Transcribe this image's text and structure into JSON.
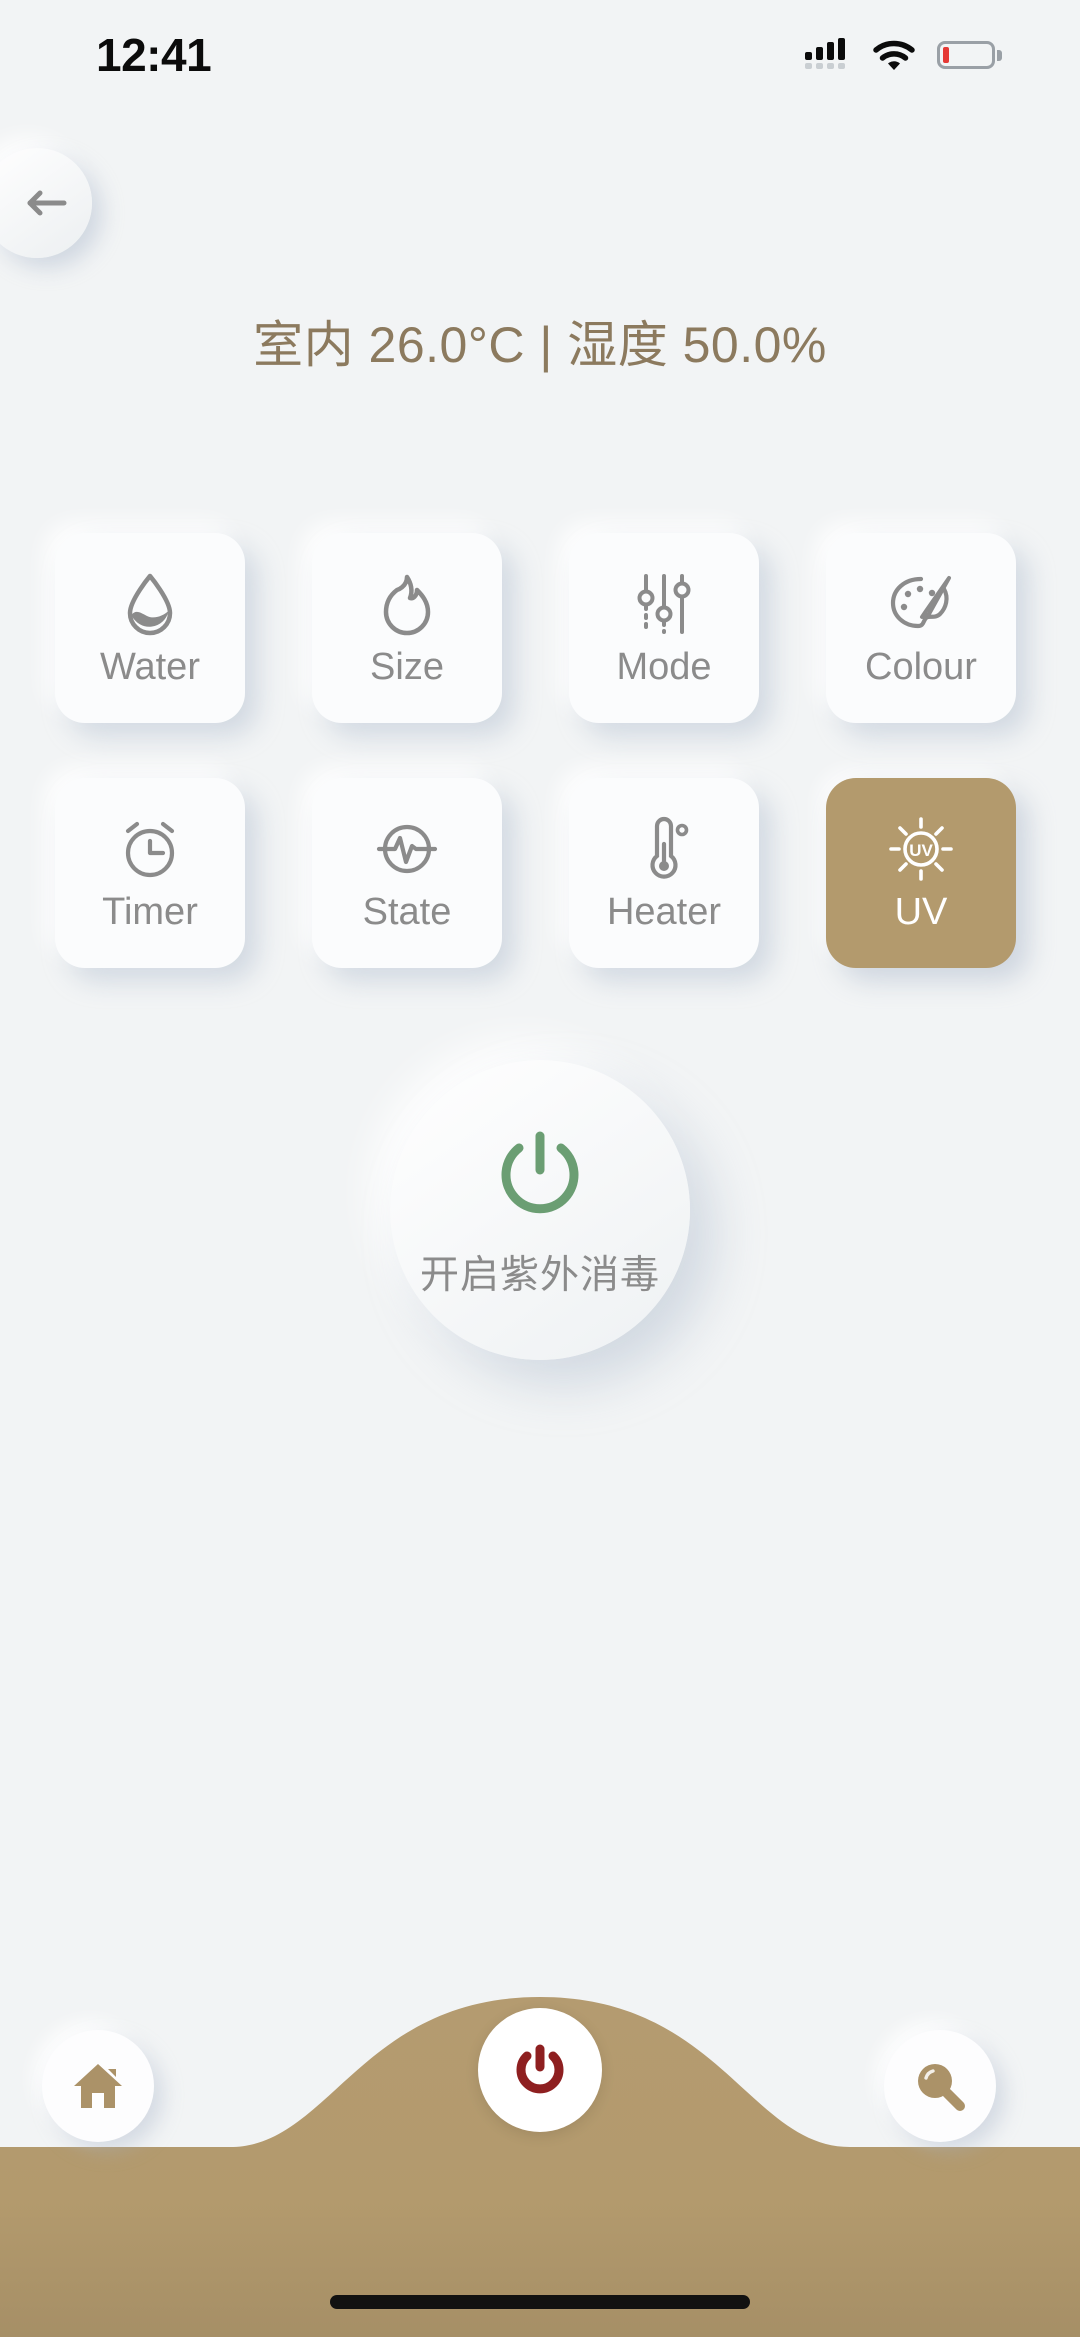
{
  "statusbar": {
    "time": "12:41",
    "signal_icon": "signal-bars-icon",
    "wifi_icon": "wifi-icon",
    "battery_icon": "battery-low-icon"
  },
  "header": {
    "back_icon": "arrow-left-icon",
    "readout": "室内 26.0°C | 湿度 50.0%",
    "indoor_label": "室内",
    "temperature": "26.0°C",
    "humidity_label": "湿度",
    "humidity": "50.0%"
  },
  "grid": {
    "tiles": [
      {
        "label": "Water",
        "icon": "water-drop-icon",
        "active": false
      },
      {
        "label": "Size",
        "icon": "flame-icon",
        "active": false
      },
      {
        "label": "Mode",
        "icon": "sliders-icon",
        "active": false
      },
      {
        "label": "Colour",
        "icon": "palette-icon",
        "active": false
      },
      {
        "label": "Timer",
        "icon": "alarm-clock-icon",
        "active": false
      },
      {
        "label": "State",
        "icon": "pulse-circle-icon",
        "active": false
      },
      {
        "label": "Heater",
        "icon": "thermometer-icon",
        "active": false
      },
      {
        "label": "UV",
        "icon": "uv-sun-icon",
        "active": true
      }
    ]
  },
  "main_power": {
    "icon": "power-icon",
    "label": "开启紫外消毒"
  },
  "bottom_nav": {
    "home_icon": "home-icon",
    "power_icon": "power-icon",
    "search_icon": "search-icon"
  },
  "colors": {
    "background": "#f2f4f5",
    "accent_tan": "#b39a6d",
    "accent_text": "#8c7a5e",
    "power_green": "#6b9e73",
    "power_red": "#8e1f20",
    "tile_label": "#8b8b8b",
    "icon_stroke": "#8b8b8b"
  }
}
